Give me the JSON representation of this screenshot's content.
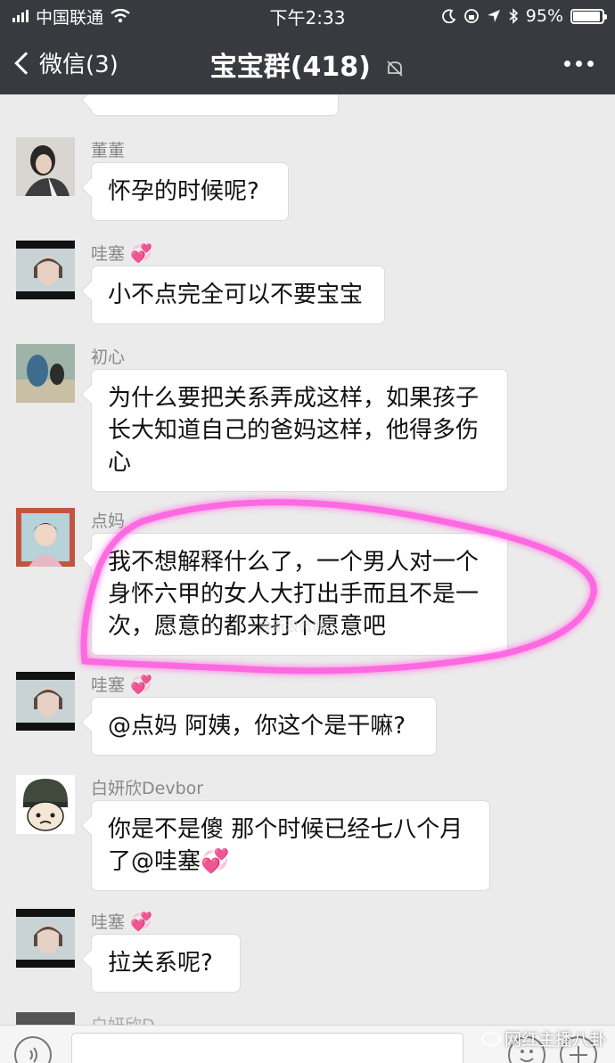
{
  "status_bar": {
    "carrier": "中国联通",
    "time": "下午2:33",
    "battery": "95%",
    "battery_level": 0.95
  },
  "nav": {
    "back_label": "微信(3)",
    "title": "宝宝群(418)",
    "more_icon": "more-dots-icon",
    "mute_icon": "mute-icon"
  },
  "messages": [
    {
      "sender": "",
      "text": "",
      "avatar": "avatar-partial"
    },
    {
      "sender": "董董",
      "text": "怀孕的时候呢?",
      "avatar": "girl-photo"
    },
    {
      "sender": "哇塞",
      "text": "小不点完全可以不要宝宝",
      "avatar": "photo-bars",
      "sender_badge": "heart-icon"
    },
    {
      "sender": "初心",
      "text": "为什么要把关系弄成这样，如果孩子\n长大知道自己的爸妈这样，他得多伤\n心",
      "avatar": "beach-photo"
    },
    {
      "sender": "点妈",
      "text": "我不想解释什么了，一个男人对一个\n身怀六甲的女人大打出手而且不是一\n次，愿意的都来打个愿意吧",
      "avatar": "child-photo"
    },
    {
      "sender": "哇塞",
      "text": "@点妈 阿姨，你这个是干嘛?",
      "avatar": "photo-bars",
      "sender_badge": "heart-icon"
    },
    {
      "sender": "白妍欣Devbor",
      "text_line1": "你是不是傻 那个时候已经七八个月",
      "text_line2": "了@哇塞",
      "avatar": "cartoon-helmet",
      "inline_badge": "heart-icon"
    },
    {
      "sender": "哇塞",
      "text": "拉关系呢?",
      "avatar": "photo-bars",
      "sender_badge": "heart-icon"
    },
    {
      "sender": "白妍欣D...",
      "text": "",
      "avatar": "partial"
    }
  ],
  "watermark": {
    "text": "网红主播八卦",
    "faint_text": "@新浪微博"
  },
  "colors": {
    "header_bg": "#393a3f",
    "chat_bg": "#ebebeb",
    "bubble_bg": "#ffffff",
    "highlight": "#ff5ce0",
    "heart": "#e660c8"
  }
}
